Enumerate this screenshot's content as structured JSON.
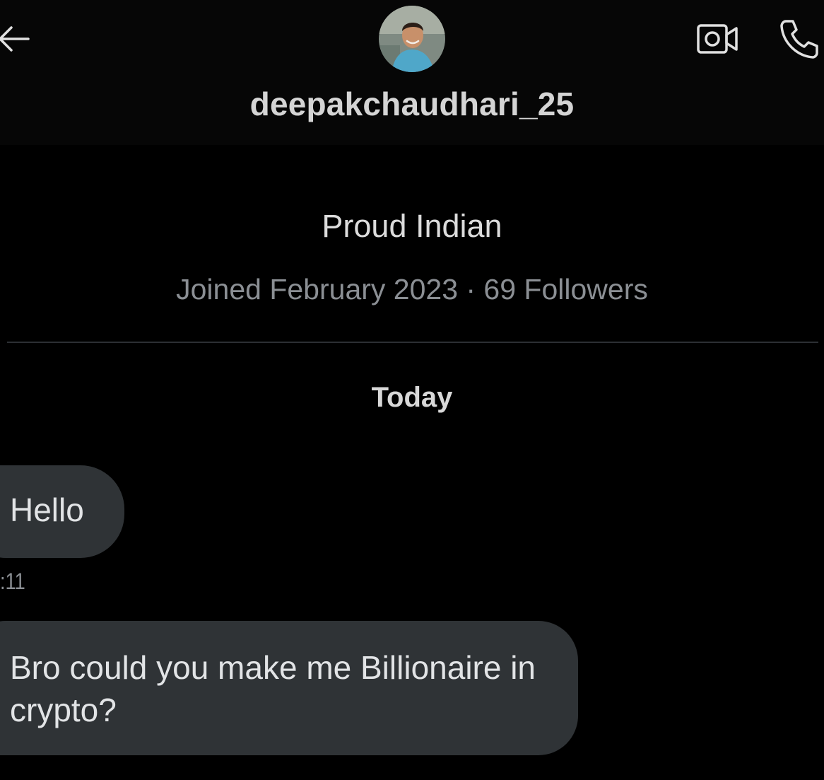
{
  "header": {
    "username": "deepakchaudhari_25",
    "icons": {
      "back": "arrow-left-icon",
      "video": "video-camera-icon",
      "call": "phone-icon"
    }
  },
  "profile": {
    "bio": "Proud Indian",
    "meta": "Joined February 2023 · 69 Followers"
  },
  "conversation": {
    "date_separator": "Today",
    "messages": [
      {
        "text": "Hello",
        "time": ":11"
      },
      {
        "text": "Bro could you make me Billionaire in crypto?"
      }
    ]
  },
  "colors": {
    "background": "#000000",
    "bubble": "#2f3336",
    "text": "#e7e9ea",
    "muted": "#8b8f94"
  }
}
